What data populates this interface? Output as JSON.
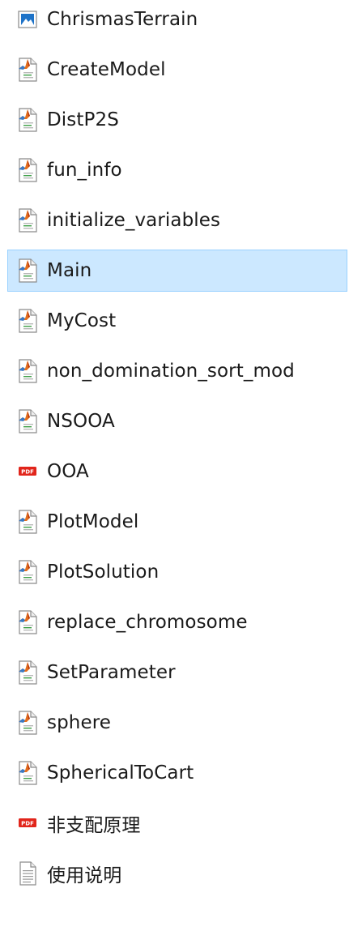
{
  "files": [
    {
      "name": "ChrismasTerrain",
      "icon": "image-file-icon",
      "selected": false
    },
    {
      "name": "CreateModel",
      "icon": "matlab-file-icon",
      "selected": false
    },
    {
      "name": "DistP2S",
      "icon": "matlab-file-icon",
      "selected": false
    },
    {
      "name": "fun_info",
      "icon": "matlab-file-icon",
      "selected": false
    },
    {
      "name": "initialize_variables",
      "icon": "matlab-file-icon",
      "selected": false
    },
    {
      "name": "Main",
      "icon": "matlab-file-icon",
      "selected": true
    },
    {
      "name": "MyCost",
      "icon": "matlab-file-icon",
      "selected": false
    },
    {
      "name": "non_domination_sort_mod",
      "icon": "matlab-file-icon",
      "selected": false
    },
    {
      "name": "NSOOA",
      "icon": "matlab-file-icon",
      "selected": false
    },
    {
      "name": "OOA",
      "icon": "pdf-file-icon",
      "selected": false
    },
    {
      "name": "PlotModel",
      "icon": "matlab-file-icon",
      "selected": false
    },
    {
      "name": "PlotSolution",
      "icon": "matlab-file-icon",
      "selected": false
    },
    {
      "name": "replace_chromosome",
      "icon": "matlab-file-icon",
      "selected": false
    },
    {
      "name": "SetParameter",
      "icon": "matlab-file-icon",
      "selected": false
    },
    {
      "name": "sphere",
      "icon": "matlab-file-icon",
      "selected": false
    },
    {
      "name": "SphericalToCart",
      "icon": "matlab-file-icon",
      "selected": false
    },
    {
      "name": "非支配原理",
      "icon": "pdf-file-icon",
      "selected": false
    },
    {
      "name": "使用说明",
      "icon": "text-file-icon",
      "selected": false
    }
  ],
  "colors": {
    "selected_bg": "#cce8ff",
    "selected_border": "#99d1ff",
    "pdf_red": "#e1251b",
    "image_blue": "#1e73c8"
  }
}
